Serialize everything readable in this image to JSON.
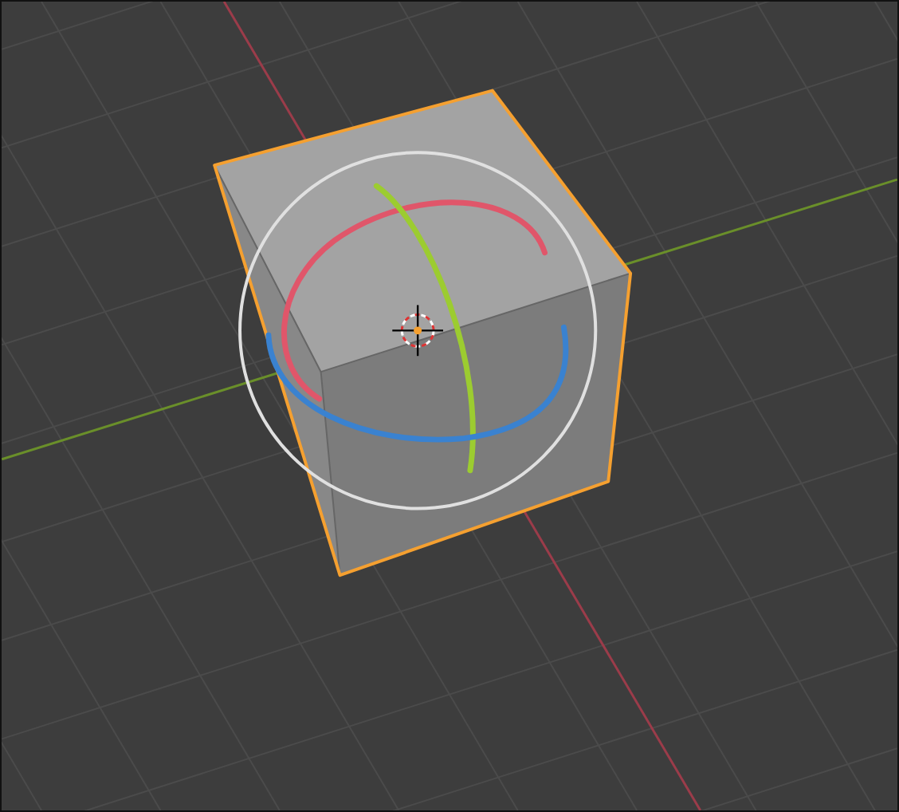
{
  "viewport": {
    "objects": [
      {
        "kind": "cube",
        "selected": true
      }
    ]
  }
}
